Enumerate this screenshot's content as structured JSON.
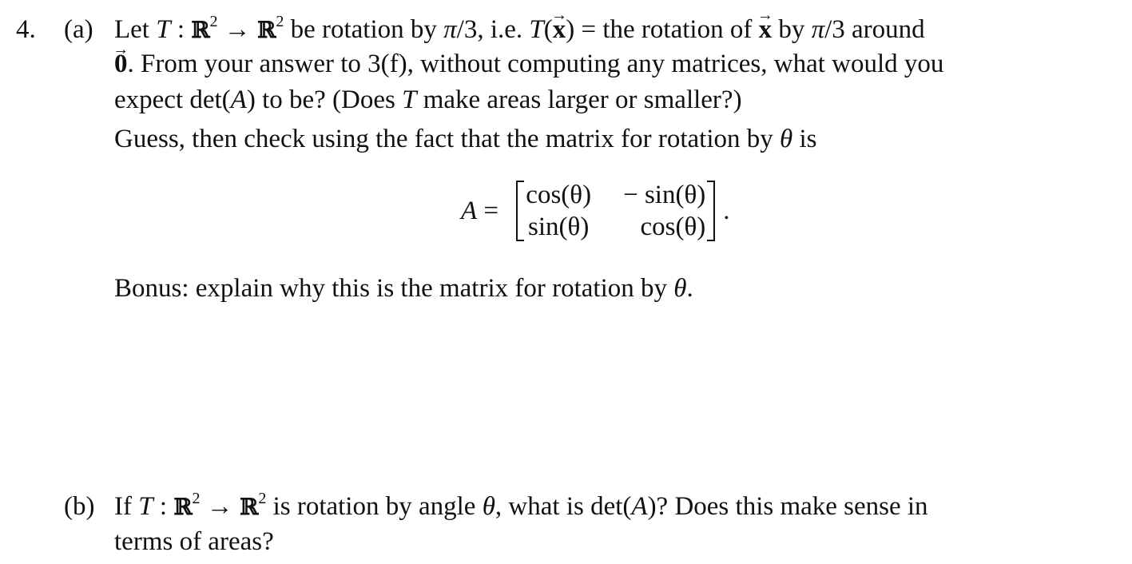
{
  "problem": {
    "number": "4.",
    "part_a": {
      "label": "(a)",
      "line1": {
        "t1": "Let ",
        "T": "T",
        "t2": " : ",
        "R1": "ℝ",
        "exp1": "2",
        "arrow": " → ",
        "R2": "ℝ",
        "exp2": "2",
        "t3": " be rotation by ",
        "pi1": "π",
        "t4": "/3, i.e. ",
        "T2": "T",
        "t5": "(",
        "x1": "x",
        "t6": ") = the rotation of ",
        "x2": "x",
        "t7": " by ",
        "pi2": "π",
        "t8": "/3 around"
      },
      "line2": {
        "zero": "0",
        "text": ". From your answer to 3(f), without computing any matrices, what would you"
      },
      "line3": {
        "t1": "expect det(",
        "A": "A",
        "t2": ") to be? (Does ",
        "T": "T",
        "t3": " make areas larger or smaller?)"
      },
      "line4": {
        "t1": "Guess, then check using the fact that the matrix for rotation by ",
        "theta": "θ",
        "t2": " is"
      },
      "equation": {
        "lhs": "A",
        "equals": " = ",
        "matrix": [
          [
            "cos(θ)",
            "− sin(θ)"
          ],
          [
            "sin(θ)",
            "cos(θ)"
          ]
        ],
        "trailing": "."
      },
      "bonus": {
        "t1": "Bonus: explain why this is the matrix for rotation by ",
        "theta": "θ",
        "t2": "."
      }
    },
    "part_b": {
      "label": "(b)",
      "line1": {
        "t1": "If ",
        "T": "T",
        "t2": " : ",
        "R1": "ℝ",
        "exp1": "2",
        "arrow": " → ",
        "R2": "ℝ",
        "exp2": "2",
        "t3": " is rotation by angle ",
        "theta": "θ",
        "t4": ", what is det(",
        "A": "A",
        "t5": ")? Does this make sense in"
      },
      "line2": "terms of areas?"
    }
  }
}
